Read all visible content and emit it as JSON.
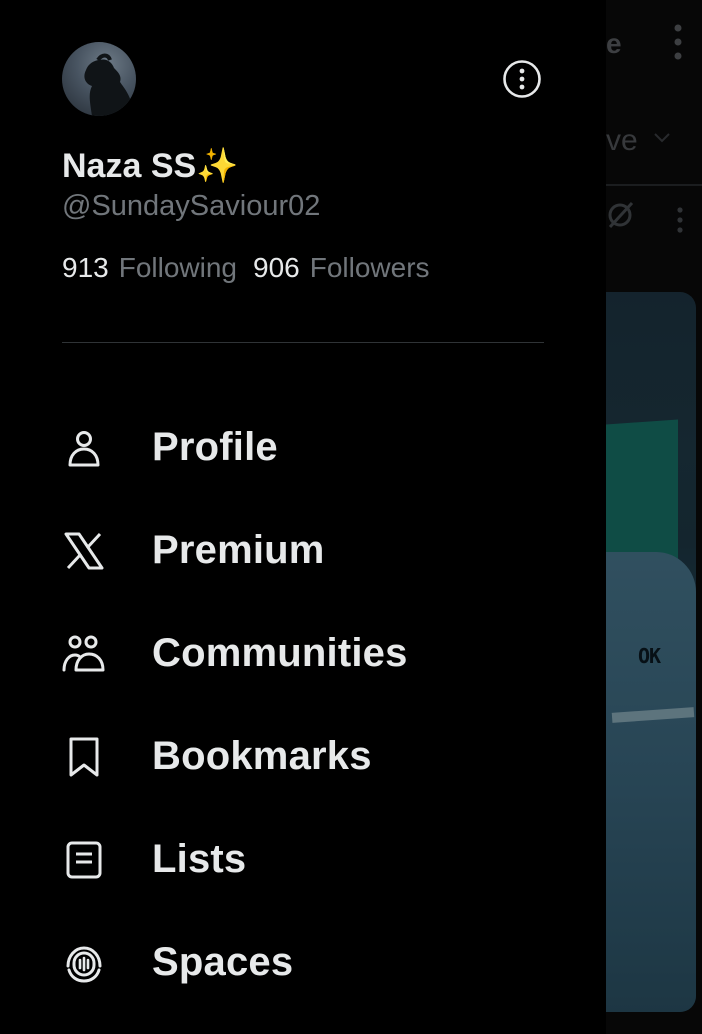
{
  "background": {
    "title_fragment": "e",
    "tab_fragment": "ve",
    "media_text_fragment": "OK"
  },
  "account": {
    "display_name": "Naza SS✨",
    "handle": "@SundaySaviour02",
    "following_count": "913",
    "following_label": "Following",
    "followers_count": "906",
    "followers_label": "Followers"
  },
  "menu": [
    {
      "label": "Profile",
      "icon": "person-icon"
    },
    {
      "label": "Premium",
      "icon": "x-logo-icon"
    },
    {
      "label": "Communities",
      "icon": "communities-icon"
    },
    {
      "label": "Bookmarks",
      "icon": "bookmark-icon"
    },
    {
      "label": "Lists",
      "icon": "list-icon"
    },
    {
      "label": "Spaces",
      "icon": "microphone-icon"
    }
  ],
  "colors": {
    "background": "#000000",
    "primary_text": "#e7e9ea",
    "secondary_text": "#71767b",
    "divider": "#2f3336"
  }
}
